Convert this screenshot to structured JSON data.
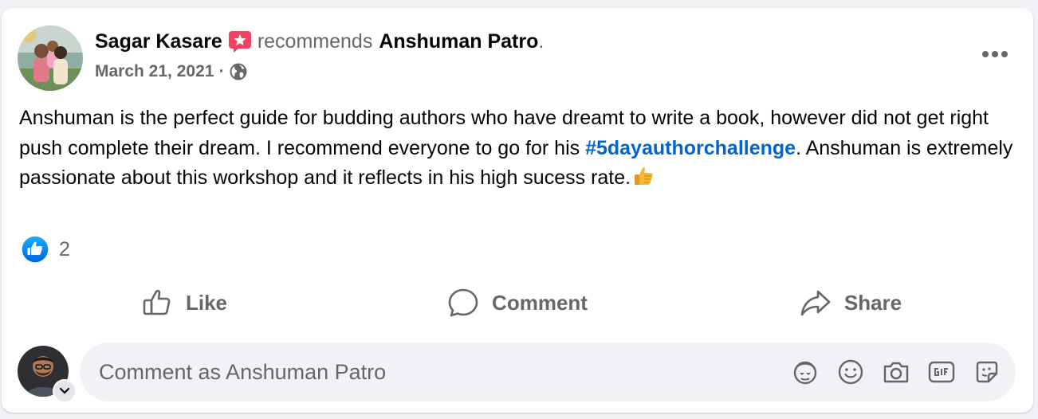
{
  "post": {
    "author": "Sagar Kasare",
    "action": "recommends",
    "page": "Anshuman Patro",
    "end_punct": ".",
    "date": "March 21, 2021",
    "meta_sep": "·",
    "audience_icon": "globe-icon",
    "body": {
      "part1": "Anshuman is the perfect guide for budding authors who have dreamt to write a book, however did not get right push complete their dream. I recommend everyone to go for his ",
      "hashtag": "#5dayauthorchallenge",
      "part2": ". Anshuman is extremely passionate about this workshop and it reflects in his high sucess rate.",
      "emoji": "thumbs-up-emoji"
    },
    "reactions": {
      "icon": "like-reaction-icon",
      "count": "2"
    }
  },
  "actions": {
    "like": "Like",
    "comment": "Comment",
    "share": "Share"
  },
  "composer": {
    "placeholder": "Comment as Anshuman Patro",
    "icons": [
      "avatar-sticker-icon",
      "emoji-icon",
      "camera-icon",
      "gif-icon",
      "sticker-icon"
    ]
  },
  "colors": {
    "brand_blue": "#0866ff",
    "hashtag_blue": "#0064d1",
    "secondary_text": "#65676b",
    "recommend_pink": "#f3425f"
  }
}
